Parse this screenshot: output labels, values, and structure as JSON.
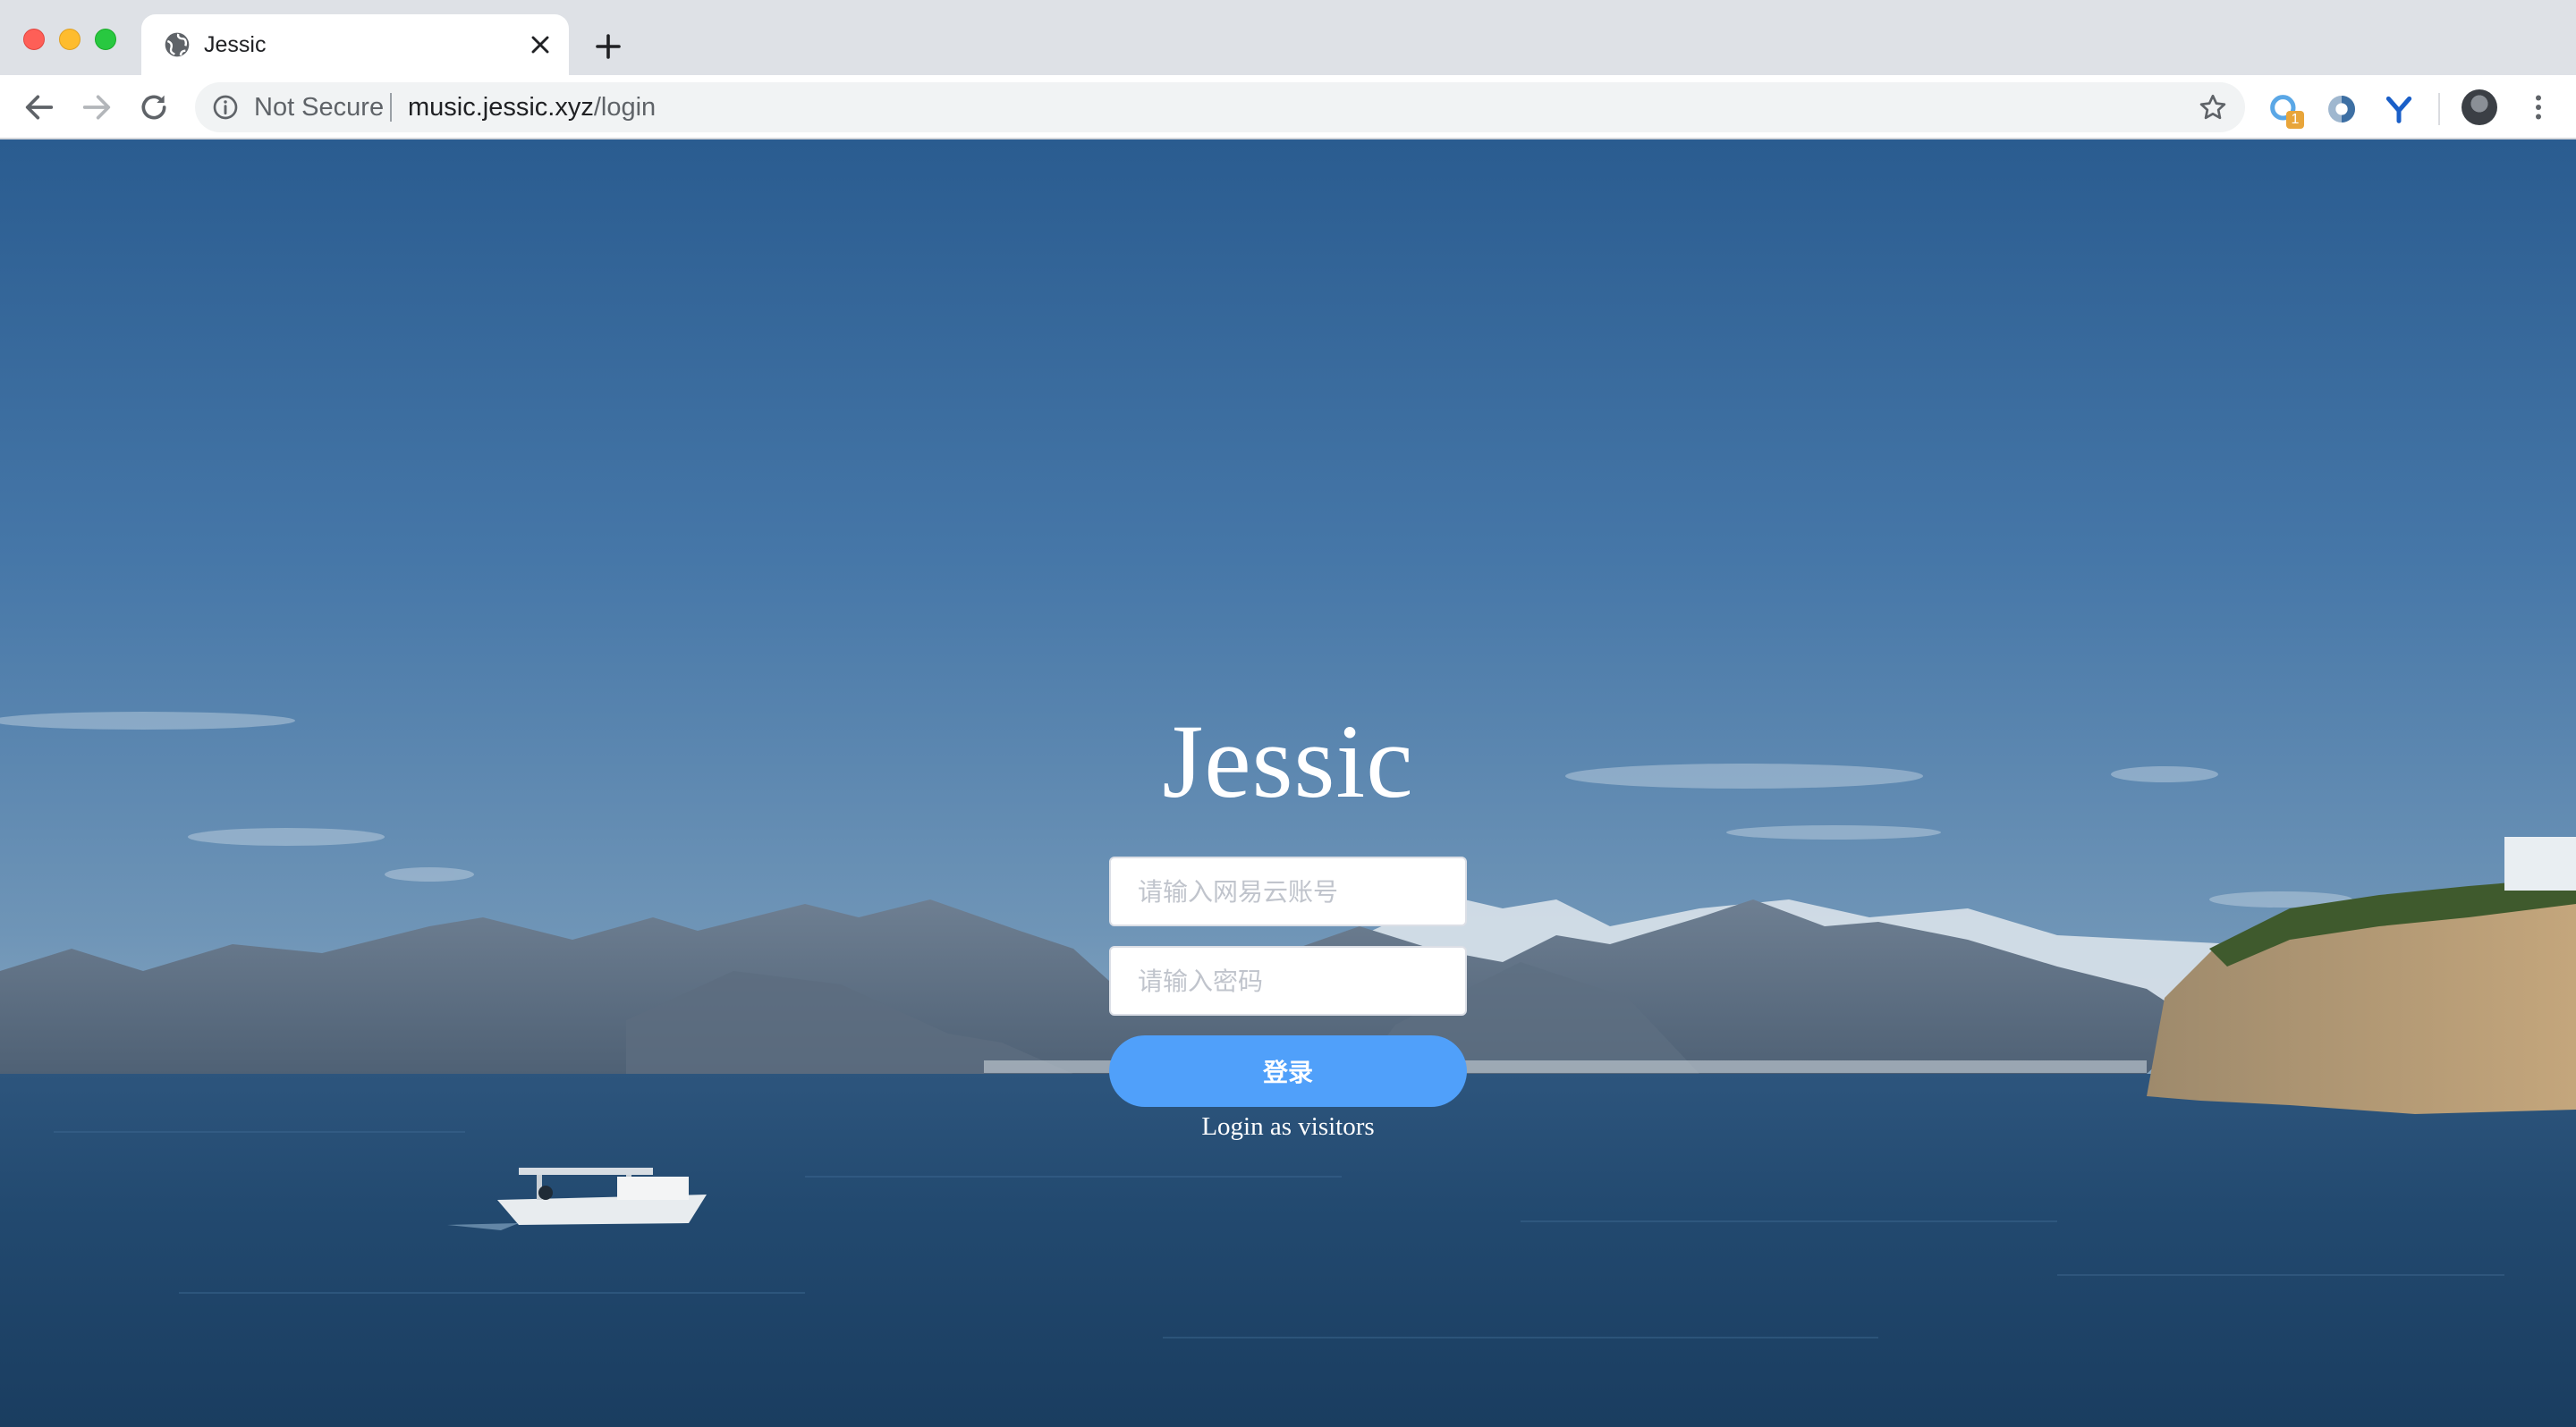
{
  "browser": {
    "tab": {
      "title": "Jessic",
      "favicon": "globe-icon"
    },
    "address_bar": {
      "security_label": "Not Secure",
      "url_host": "music.jessic.xyz",
      "url_path": "/login"
    },
    "extensions": [
      {
        "name": "extension-blue-ring",
        "badge": "1"
      },
      {
        "name": "extension-half-circle"
      },
      {
        "name": "extension-y-logo"
      }
    ]
  },
  "page": {
    "app_title": "Jessic",
    "account_placeholder": "请输入网易云账号",
    "password_placeholder": "请输入密码",
    "login_button": "登录",
    "visitor_link": "Login as visitors",
    "colors": {
      "primary_button": "#50a0fa",
      "sky_top": "#2c5f93",
      "sea": "#21496f"
    }
  }
}
